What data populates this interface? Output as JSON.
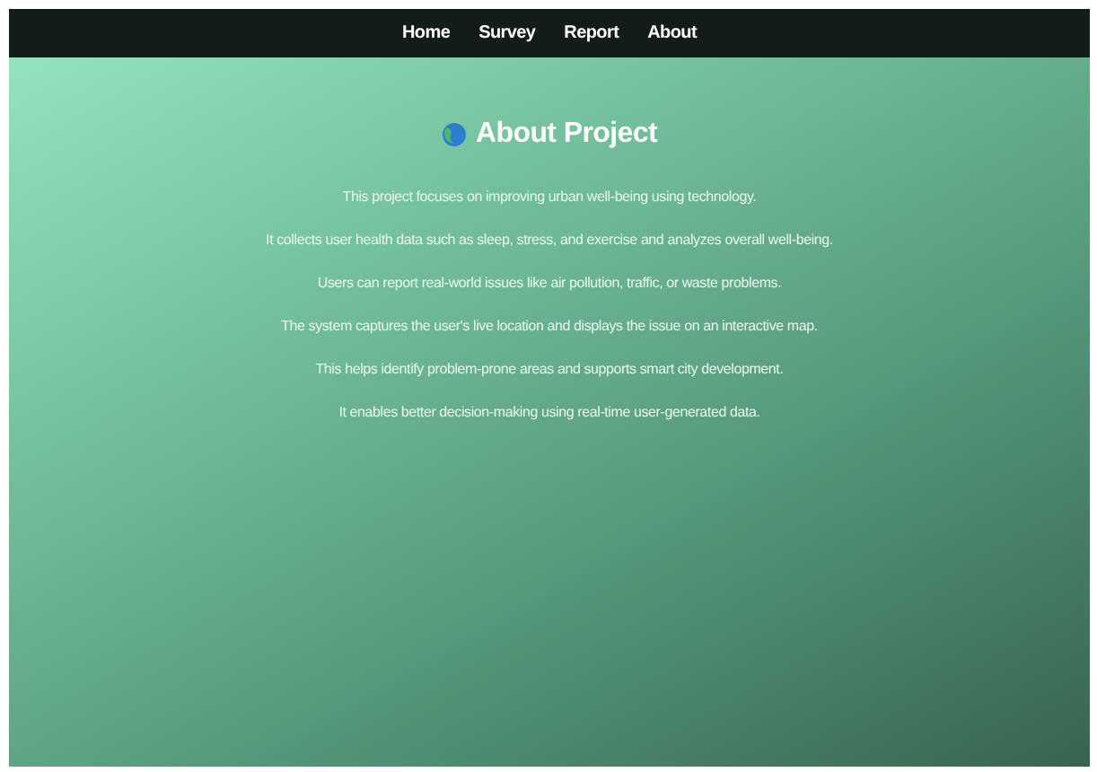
{
  "nav": {
    "links": [
      {
        "label": "Home"
      },
      {
        "label": "Survey"
      },
      {
        "label": "Report"
      },
      {
        "label": "About"
      }
    ]
  },
  "title": "About Project",
  "paragraphs": [
    "This project focuses on improving urban well-being using technology.",
    "It collects user health data such as sleep, stress, and exercise and analyzes overall well-being.",
    "Users can report real-world issues like air pollution, traffic, or waste problems.",
    "The system captures the user's live location and displays the issue on an interactive map.",
    "This helps identify problem-prone areas and supports smart city development.",
    "It enables better decision-making using real-time user-generated data."
  ]
}
